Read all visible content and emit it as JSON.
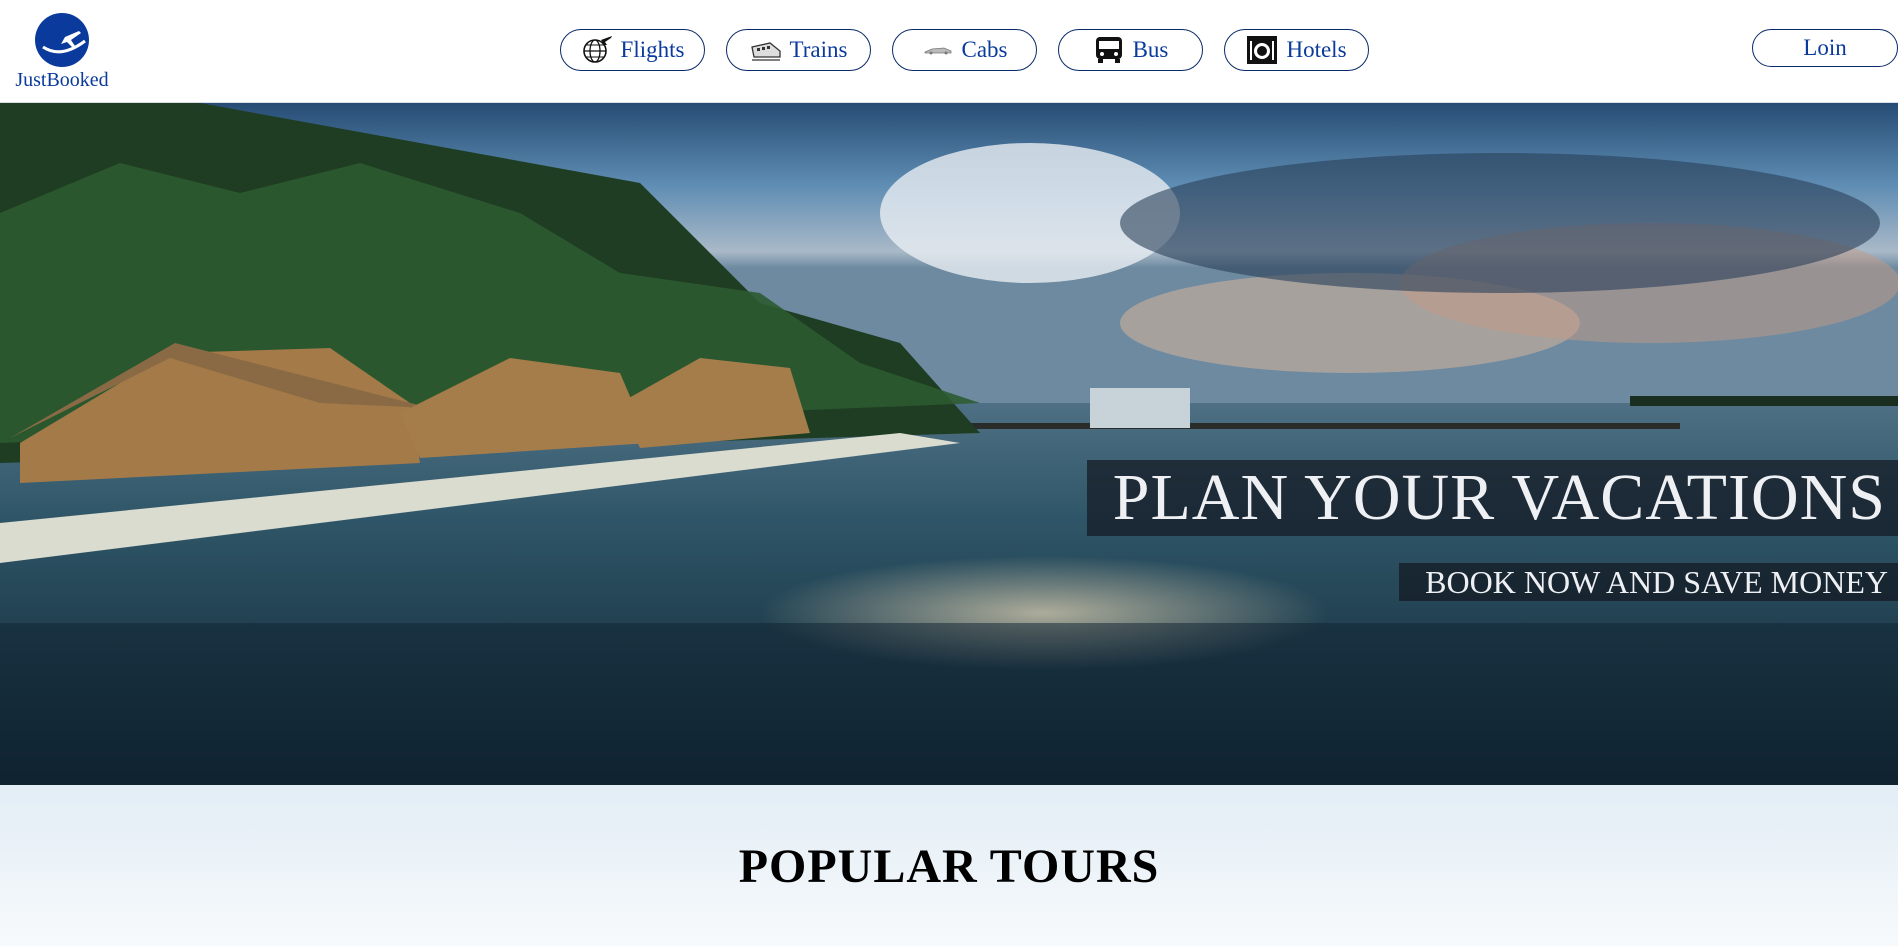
{
  "brand": {
    "name": "JustBooked",
    "logo_color": "#0a3a9c"
  },
  "nav": {
    "items": [
      {
        "label": "Flights",
        "icon": "globe-plane-icon"
      },
      {
        "label": "Trains",
        "icon": "train-icon"
      },
      {
        "label": "Cabs",
        "icon": "cab-icon"
      },
      {
        "label": "Bus",
        "icon": "bus-icon"
      },
      {
        "label": "Hotels",
        "icon": "hotel-dining-icon"
      }
    ]
  },
  "login_label": "Loin",
  "hero": {
    "title": "PLAN YOUR VACATIONS",
    "subtitle": "BOOK NOW AND SAVE MONEY"
  },
  "tours": {
    "title": "POPULAR TOURS"
  },
  "colors": {
    "accent": "#0a3a9c",
    "overlay": "#14192354"
  }
}
